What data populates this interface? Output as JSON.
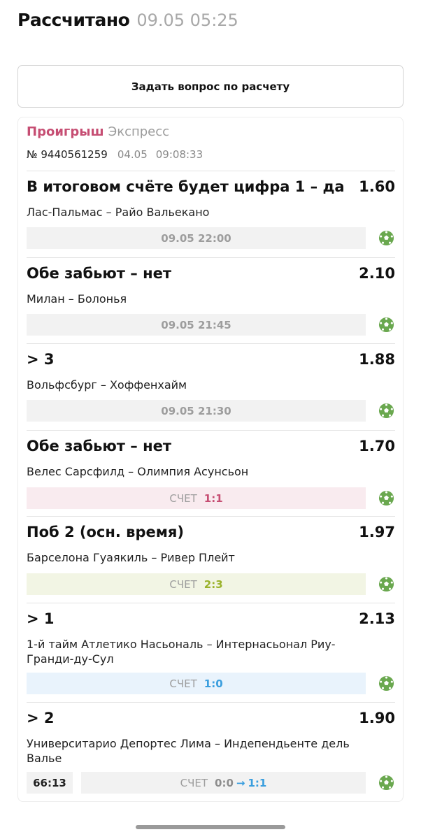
{
  "header": {
    "title": "Рассчитано",
    "date": "09.05 05:25"
  },
  "ask_button": "Задать вопрос по расчету",
  "coupon": {
    "status": "Проигрыш",
    "type": "Экспресс",
    "number": "№ 9440561259",
    "date": "04.05",
    "time": "09:08:33"
  },
  "score_label": "СЧЕТ",
  "events": [
    {
      "market": "В итоговом счёте будет цифра 1 – да",
      "odds": "1.60",
      "teams": "Лас-Пальмас – Райо Вальекано",
      "info": "09.05 22:00",
      "icon": "football-icon"
    },
    {
      "market": "Обе забьют – нет",
      "odds": "2.10",
      "teams": "Милан – Болонья",
      "info": "09.05 21:45",
      "icon": "football-icon"
    },
    {
      "market": "> 3",
      "odds": "1.88",
      "teams": "Вольфсбург – Хоффенхайм",
      "info": "09.05 21:30",
      "icon": "football-icon"
    },
    {
      "market": "Обе забьют – нет",
      "odds": "1.70",
      "teams": "Велес Сарсфилд – Олимпия Асунсьон",
      "score": "1:1",
      "score_color": "#c64e73",
      "icon": "football-icon"
    },
    {
      "market": "Поб 2 (осн. время)",
      "odds": "1.97",
      "teams": "Барселона Гуаякиль – Ривер Плейт",
      "score": "2:3",
      "score_color": "#9ab22a",
      "icon": "football-icon"
    },
    {
      "market": "> 1",
      "odds": "2.13",
      "teams": "1-й тайм Атлетико Насьональ – Интернасьонал Риу-Гранди-ду-Сул",
      "score": "1:0",
      "score_color": "#3a9ede",
      "icon": "football-icon"
    },
    {
      "market": "> 2",
      "odds": "1.90",
      "teams": "Университарио Депортес Лима – Индепендьенте дель Валье",
      "live_time": "66:13",
      "score_from": "0:0",
      "score_to": "1:1",
      "score_color": "#3a9ede",
      "icon": "football-icon"
    }
  ],
  "colors": {
    "loss": "#c64e73",
    "muted": "#9b9b9b",
    "ball": "#6aa84f"
  }
}
